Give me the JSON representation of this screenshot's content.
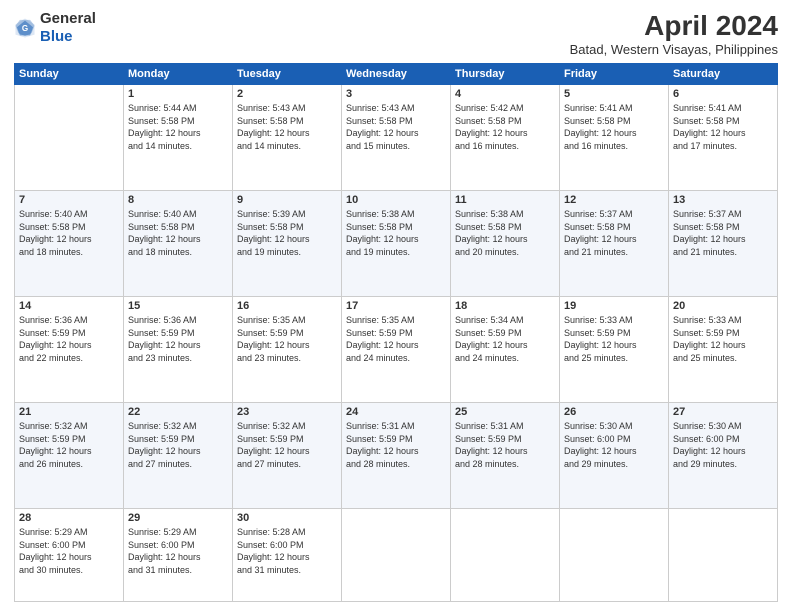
{
  "header": {
    "logo_general": "General",
    "logo_blue": "Blue",
    "month_year": "April 2024",
    "location": "Batad, Western Visayas, Philippines"
  },
  "days_of_week": [
    "Sunday",
    "Monday",
    "Tuesday",
    "Wednesday",
    "Thursday",
    "Friday",
    "Saturday"
  ],
  "weeks": [
    [
      {
        "day": "",
        "info": ""
      },
      {
        "day": "1",
        "info": "Sunrise: 5:44 AM\nSunset: 5:58 PM\nDaylight: 12 hours\nand 14 minutes."
      },
      {
        "day": "2",
        "info": "Sunrise: 5:43 AM\nSunset: 5:58 PM\nDaylight: 12 hours\nand 14 minutes."
      },
      {
        "day": "3",
        "info": "Sunrise: 5:43 AM\nSunset: 5:58 PM\nDaylight: 12 hours\nand 15 minutes."
      },
      {
        "day": "4",
        "info": "Sunrise: 5:42 AM\nSunset: 5:58 PM\nDaylight: 12 hours\nand 16 minutes."
      },
      {
        "day": "5",
        "info": "Sunrise: 5:41 AM\nSunset: 5:58 PM\nDaylight: 12 hours\nand 16 minutes."
      },
      {
        "day": "6",
        "info": "Sunrise: 5:41 AM\nSunset: 5:58 PM\nDaylight: 12 hours\nand 17 minutes."
      }
    ],
    [
      {
        "day": "7",
        "info": "Sunrise: 5:40 AM\nSunset: 5:58 PM\nDaylight: 12 hours\nand 18 minutes."
      },
      {
        "day": "8",
        "info": "Sunrise: 5:40 AM\nSunset: 5:58 PM\nDaylight: 12 hours\nand 18 minutes."
      },
      {
        "day": "9",
        "info": "Sunrise: 5:39 AM\nSunset: 5:58 PM\nDaylight: 12 hours\nand 19 minutes."
      },
      {
        "day": "10",
        "info": "Sunrise: 5:38 AM\nSunset: 5:58 PM\nDaylight: 12 hours\nand 19 minutes."
      },
      {
        "day": "11",
        "info": "Sunrise: 5:38 AM\nSunset: 5:58 PM\nDaylight: 12 hours\nand 20 minutes."
      },
      {
        "day": "12",
        "info": "Sunrise: 5:37 AM\nSunset: 5:58 PM\nDaylight: 12 hours\nand 21 minutes."
      },
      {
        "day": "13",
        "info": "Sunrise: 5:37 AM\nSunset: 5:58 PM\nDaylight: 12 hours\nand 21 minutes."
      }
    ],
    [
      {
        "day": "14",
        "info": "Sunrise: 5:36 AM\nSunset: 5:59 PM\nDaylight: 12 hours\nand 22 minutes."
      },
      {
        "day": "15",
        "info": "Sunrise: 5:36 AM\nSunset: 5:59 PM\nDaylight: 12 hours\nand 23 minutes."
      },
      {
        "day": "16",
        "info": "Sunrise: 5:35 AM\nSunset: 5:59 PM\nDaylight: 12 hours\nand 23 minutes."
      },
      {
        "day": "17",
        "info": "Sunrise: 5:35 AM\nSunset: 5:59 PM\nDaylight: 12 hours\nand 24 minutes."
      },
      {
        "day": "18",
        "info": "Sunrise: 5:34 AM\nSunset: 5:59 PM\nDaylight: 12 hours\nand 24 minutes."
      },
      {
        "day": "19",
        "info": "Sunrise: 5:33 AM\nSunset: 5:59 PM\nDaylight: 12 hours\nand 25 minutes."
      },
      {
        "day": "20",
        "info": "Sunrise: 5:33 AM\nSunset: 5:59 PM\nDaylight: 12 hours\nand 25 minutes."
      }
    ],
    [
      {
        "day": "21",
        "info": "Sunrise: 5:32 AM\nSunset: 5:59 PM\nDaylight: 12 hours\nand 26 minutes."
      },
      {
        "day": "22",
        "info": "Sunrise: 5:32 AM\nSunset: 5:59 PM\nDaylight: 12 hours\nand 27 minutes."
      },
      {
        "day": "23",
        "info": "Sunrise: 5:32 AM\nSunset: 5:59 PM\nDaylight: 12 hours\nand 27 minutes."
      },
      {
        "day": "24",
        "info": "Sunrise: 5:31 AM\nSunset: 5:59 PM\nDaylight: 12 hours\nand 28 minutes."
      },
      {
        "day": "25",
        "info": "Sunrise: 5:31 AM\nSunset: 5:59 PM\nDaylight: 12 hours\nand 28 minutes."
      },
      {
        "day": "26",
        "info": "Sunrise: 5:30 AM\nSunset: 6:00 PM\nDaylight: 12 hours\nand 29 minutes."
      },
      {
        "day": "27",
        "info": "Sunrise: 5:30 AM\nSunset: 6:00 PM\nDaylight: 12 hours\nand 29 minutes."
      }
    ],
    [
      {
        "day": "28",
        "info": "Sunrise: 5:29 AM\nSunset: 6:00 PM\nDaylight: 12 hours\nand 30 minutes."
      },
      {
        "day": "29",
        "info": "Sunrise: 5:29 AM\nSunset: 6:00 PM\nDaylight: 12 hours\nand 31 minutes."
      },
      {
        "day": "30",
        "info": "Sunrise: 5:28 AM\nSunset: 6:00 PM\nDaylight: 12 hours\nand 31 minutes."
      },
      {
        "day": "",
        "info": ""
      },
      {
        "day": "",
        "info": ""
      },
      {
        "day": "",
        "info": ""
      },
      {
        "day": "",
        "info": ""
      }
    ]
  ]
}
